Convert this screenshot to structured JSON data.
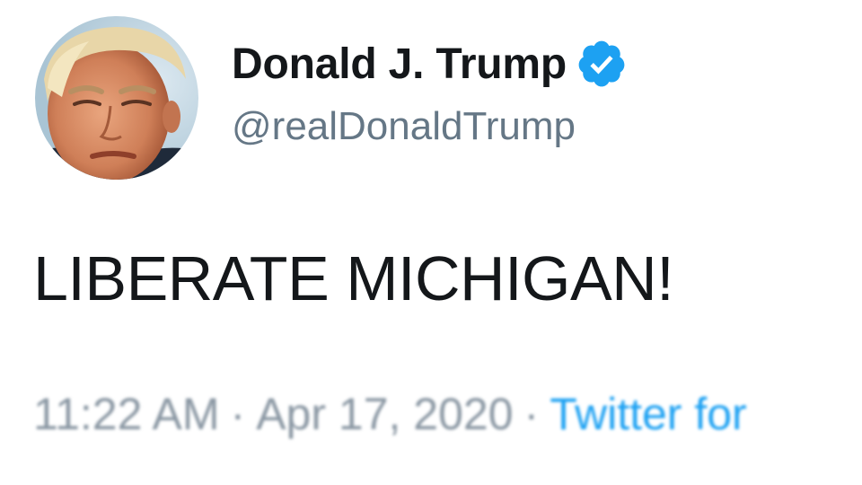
{
  "author": {
    "display_name": "Donald J. Trump",
    "handle": "@realDonaldTrump",
    "verified": true,
    "avatar_icon": "profile-photo"
  },
  "tweet": {
    "text": "LIBERATE MICHIGAN!"
  },
  "meta": {
    "time": "11:22 AM",
    "separator": "·",
    "date": "Apr 17, 2020",
    "source": "Twitter for"
  },
  "colors": {
    "text": "#14171a",
    "secondary": "#657786",
    "link": "#1da1f2",
    "verified_badge": "#1da1f2"
  }
}
